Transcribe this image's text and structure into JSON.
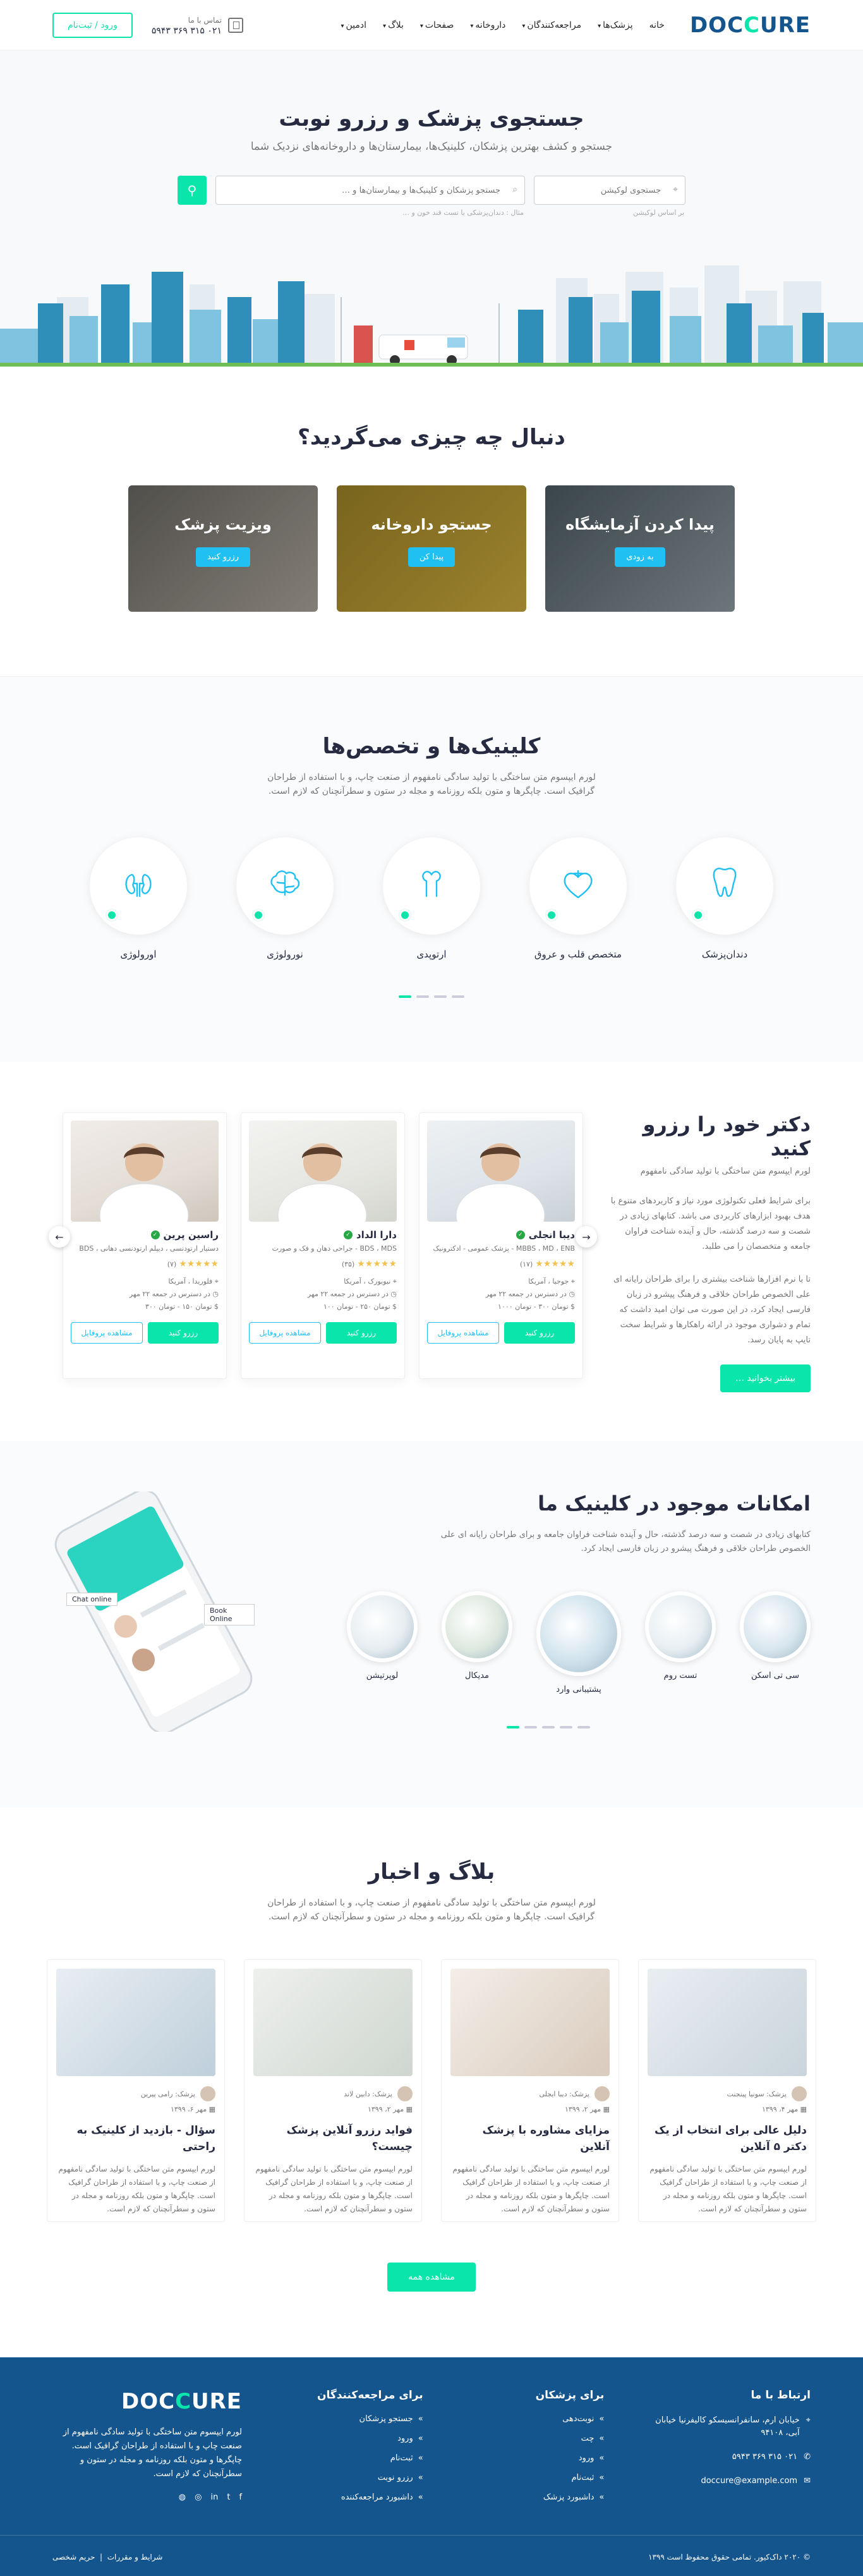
{
  "header": {
    "logo_left": "DOC",
    "logo_accent": "C",
    "logo_right": "URE",
    "nav": [
      {
        "label": "خانه",
        "dropdown": false,
        "active": true
      },
      {
        "label": "پزشک‌ها",
        "dropdown": true,
        "active": false
      },
      {
        "label": "مراجعه‌کنندگان",
        "dropdown": true,
        "active": false
      },
      {
        "label": "داروخانه",
        "dropdown": true,
        "active": false
      },
      {
        "label": "صفحات",
        "dropdown": true,
        "active": false
      },
      {
        "label": "بلاگ",
        "dropdown": true,
        "active": false
      },
      {
        "label": "ادمین",
        "dropdown": true,
        "active": false
      }
    ],
    "contact_label": "تماس با ما",
    "contact_phone": "۰۲۱ ۳۱۵ ۳۶۹ ۵۹۴۳",
    "login": "ورود / ثبت‌نام"
  },
  "hero": {
    "title": "جستجوی پزشک و رزرو نوبت",
    "subtitle": "جستجو و کشف بهترین پزشکان، کلینیک‌ها، بیمارستان‌ها و داروخانه‌های نزدیک شما",
    "location_placeholder": "جستجوی لوکیشن",
    "location_hint": "بر اساس لوکیشن",
    "keyword_placeholder": "جستجو پزشکان و کلینیک‌ها و بیمارستان‌ها و …",
    "keyword_hint": "مثال : دندان‌پزشکی یا تست قند خون و …"
  },
  "find": {
    "title": "دنبال چه چیزی می‌گردید؟",
    "cards": [
      {
        "title": "پیدا کردن آزمایشگاه",
        "button": "به زودی",
        "c1": "#5a6b74",
        "c2": "#a8b6bd"
      },
      {
        "title": "جستجو داروخانه",
        "button": "پیدا کن",
        "c1": "#b99a2c",
        "c2": "#f1c94a"
      },
      {
        "title": "ویزیت پزشک",
        "button": "رزرو کنید",
        "c1": "#7d7a74",
        "c2": "#c9c2b6"
      }
    ]
  },
  "specialities": {
    "title": "کلینیک‌ها و تخصص‌ها",
    "description": "لورم ایپسوم متن ساختگی با تولید سادگی نامفهوم از صنعت چاپ، و با استفاده از طراحان گرافیک است. چاپگرها و متون بلکه روزنامه و مجله در ستون و سطرآنچنان که لازم است.",
    "items": [
      {
        "name": "دندان‌پزشک",
        "icon": "tooth-icon"
      },
      {
        "name": "متخصص قلب و عروق",
        "icon": "heart-icon"
      },
      {
        "name": "ارتوپدی",
        "icon": "bone-icon"
      },
      {
        "name": "نورولوژی",
        "icon": "brain-icon"
      },
      {
        "name": "اورولوژی",
        "icon": "kidney-icon"
      }
    ]
  },
  "doctors": {
    "title": "دکتر خود را رزرو کنید",
    "lead": "لورم ایپسوم متن ساختگی با تولید سادگی نامفهوم",
    "para1": "برای شرایط فعلی تکنولوژی مورد نیاز و کاربردهای متنوع با هدف بهبود ابزارهای کاربردی می باشد. کتابهای زیادی در شصت و سه درصد گذشته، حال و آینده شناخت فراوان جامعه و متخصصان را می طلبد.",
    "para2": "تا با نرم افزارها شناخت بیشتری را برای طراحان رایانه ای علی الخصوص طراحان خلاقی و فرهنگ پیشرو در زبان فارسی ایجاد کرد، در این صورت می توان امید داشت که تمام و دشواری موجود در ارائه راهکارها و شرایط سخت تایپ به پایان رسد.",
    "more": "بیشتر بخوانید …",
    "cards": [
      {
        "name": "دیبا انجلی",
        "spec": "MBBS ، MD ، ENB - پزشک عمومی - ادکترونیک",
        "reviews": "(۱۷)",
        "location": "جوجیا ، آمریکا",
        "available": "در دسترس در جمعه ۲۲ مهر",
        "price": "تومان ۳۰۰ - تومان ۱۰۰۰",
        "book": "رزرو کنید",
        "profile": "مشاهده پروفایل"
      },
      {
        "name": "دارا الداد",
        "spec": "BDS ، MDS - جراحی دهان و فک و صورت",
        "reviews": "(۳۵)",
        "location": "نیویورک ، آمریکا",
        "available": "در دسترس در جمعه ۲۲ مهر",
        "price": "تومان ۲۵۰ - تومان ۱۰۰",
        "book": "رزرو کنید",
        "profile": "مشاهده پروفایل"
      },
      {
        "name": "راسین پرین",
        "spec": "دستیار ارتودنسی ، دیپلم ارتودنسی دهانی ، BDS",
        "reviews": "(۷)",
        "location": "فلوریدا ، آمریکا",
        "available": "در دسترس در جمعه ۲۲ مهر",
        "price": "تومان ۱۵۰ - تومان ۳۰۰",
        "book": "رزرو کنید",
        "profile": "مشاهده پروفایل"
      }
    ]
  },
  "features": {
    "title": "امکانات موجود در کلینیک ما",
    "description": "کتابهای زیادی در شصت و سه درصد گذشته، حال و آینده شناخت فراوان جامعه و برای طراحان رایانه ای علی الخصوص طراحان خلاقی و فرهنگ پیشرو در زبان فارسی ایجاد کرد.",
    "items": [
      "سی تی اسکن",
      "تست روم",
      "پشتیبانی وارد",
      "مدیکال",
      "لوپرتیشن"
    ],
    "phone_labels": [
      "Chat online",
      "Book Online"
    ]
  },
  "blog": {
    "title": "بلاگ و اخبار",
    "description": "لورم ایپسوم متن ساختگی با تولید سادگی نامفهوم از صنعت چاپ، و با استفاده از طراحان گرافیک است. چاپگرها و متون بلکه روزنامه و مجله در ستون و سطرآنچنان که لازم است.",
    "posts": [
      {
        "author": "پزشک: سونیا پینجنت",
        "date": "مهر ۴، ۱۳۹۹",
        "title": "دلیل عالی برای انتخاب از یک دکتر ۵ آنلاین",
        "excerpt": "لورم ایپسوم متن ساختگی با تولید سادگی نامفهوم از صنعت چاپ، و با استفاده از طراحان گرافیک است. چاپگرها و متون بلکه روزنامه و مجله در ستون و سطرآنچنان که لازم است."
      },
      {
        "author": "پزشک: دیبا ایجلی",
        "date": "مهر ۲، ۱۳۹۹",
        "title": "مزایای مشاوره با پزشک آنلاین",
        "excerpt": "لورم ایپسوم متن ساختگی با تولید سادگی نامفهوم از صنعت چاپ، و با استفاده از طراحان گرافیک است. چاپگرها و متون بلکه روزنامه و مجله در ستون و سطرآنچنان که لازم است."
      },
      {
        "author": "پزشک: دابین لاند",
        "date": "مهر ۲، ۱۳۹۹",
        "title": "فواید رزرو آنلاین پزشک چیست؟",
        "excerpt": "لورم ایپسوم متن ساختگی با تولید سادگی نامفهوم از صنعت چاپ، و با استفاده از طراحان گرافیک است. چاپگرها و متون بلکه روزنامه و مجله در ستون و سطرآنچنان که لازم است."
      },
      {
        "author": "پزشک: رامی پیرین",
        "date": "مهر ۶، ۱۳۹۹",
        "title": "سؤال - بازدید از کلینیک به راحتی",
        "excerpt": "لورم ایپسوم متن ساختگی با تولید سادگی نامفهوم از صنعت چاپ، و با استفاده از طراحان گرافیک است. چاپگرها و متون بلکه روزنامه و مجله در ستون و سطرآنچنان که لازم است."
      }
    ],
    "view_all": "مشاهده همه"
  },
  "footer": {
    "about": "لورم ایپسوم متن ساختگی با تولید سادگی نامفهوم از صنعت چاپ و با استفاده از طراحان گرافیک است. چاپگرها و متون بلکه روزنامه و مجله در ستون و سطرآنچنان که لازم است.",
    "patients_title": "برای مراجعه‌کنندگان",
    "patients_links": [
      "جستجو پزشکان",
      "ورود",
      "ثبت‌نام",
      "رزرو نوبت",
      "داشبورد مراجعه‌کننده"
    ],
    "doctors_title": "برای پزشکان",
    "doctors_links": [
      "نوبت‌دهی",
      "چت",
      "ورود",
      "ثبت‌نام",
      "داشبورد پزشک"
    ],
    "contact_title": "ارتباط با ما",
    "address": "خیابان ارم، سانفرانسیسکو کالیفرنیا خیابان آبی، ۹۴۱۰۸",
    "phone": "۰۲۱ ۳۱۵ ۳۶۹ ۵۹۴۳",
    "email": "doccure@example.com",
    "copyright": "© ۲۰۲۰ داک‌کیور. تمامی حقوق محفوظ است ۱۳۹۹",
    "legal": [
      "شرایط و مقررات",
      "حریم شخصی"
    ]
  }
}
